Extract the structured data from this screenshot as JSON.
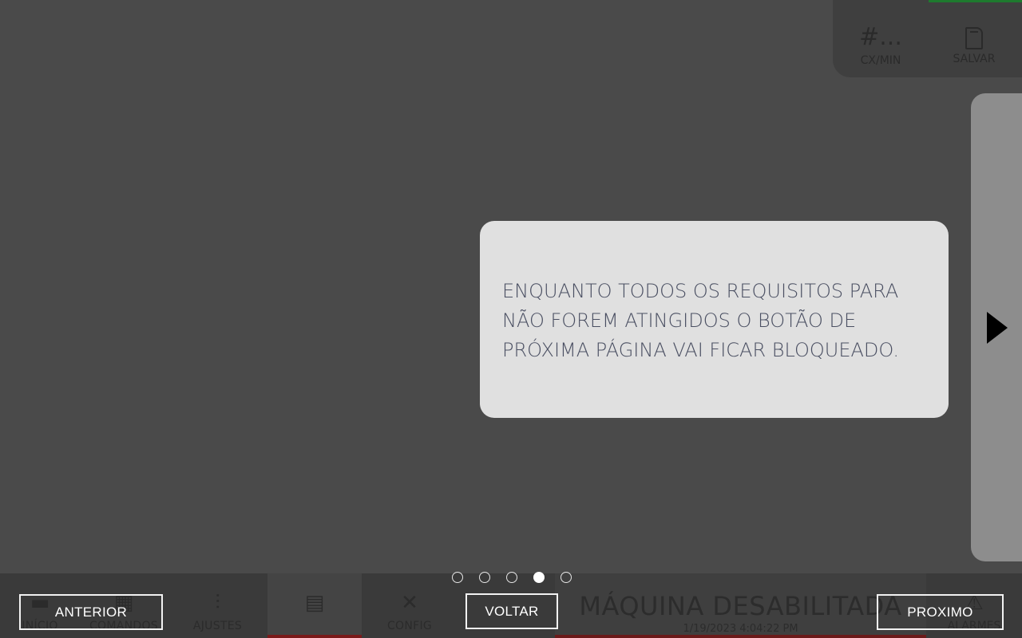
{
  "top_panel": {
    "rate_value": "#...",
    "rate_label": "CX/MIN",
    "save_label": "SALVAR"
  },
  "nav": [
    {
      "label": "INÍCIO",
      "icon": "home-icon"
    },
    {
      "label": "COMANDOS",
      "icon": "grid-icon"
    },
    {
      "label": "AJUSTES",
      "icon": "sliders-icon"
    },
    {
      "label": "",
      "icon": "boxes-icon"
    },
    {
      "label": "CONFIG",
      "icon": "tools-icon"
    }
  ],
  "status": {
    "title": "MÁQUINA DESABILITADA",
    "timestamp": "1/19/2023 4:04:22 PM"
  },
  "alarm": {
    "label": "ALARMES",
    "icon": "warning-icon"
  },
  "tutorial": {
    "message_line1": "ENQUANTO TODOS OS REQUISITOS PARA",
    "message_line2": "NÃO FOREM ATINGIDOS O BOTÃO DE",
    "message_line3": "PRÓXIMA PÁGINA VAI FICAR BLOQUEADO.",
    "total_steps": 5,
    "current_step": 4,
    "prev_label": "ANTERIOR",
    "back_label": "VOLTAR",
    "next_label": "PROXIMO"
  },
  "colors": {
    "overlay_bg": "#4a4a4a",
    "bubble_bg": "#e0e0e0",
    "bubble_text": "#4a4f62",
    "status_accent": "#6b1a1a",
    "top_accent": "#1e7a2e"
  }
}
